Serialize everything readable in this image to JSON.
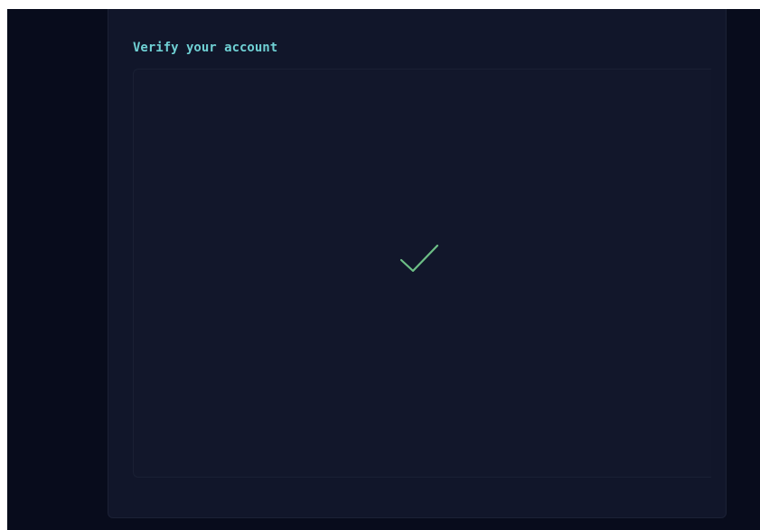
{
  "card": {
    "title": "Verify your account"
  },
  "verification": {
    "status_icon": "checkmark-icon",
    "icon_color": "#6dbf86"
  },
  "colors": {
    "page_background": "#080c1c",
    "card_background": "#11162a",
    "title_color": "#6fd0d4"
  }
}
